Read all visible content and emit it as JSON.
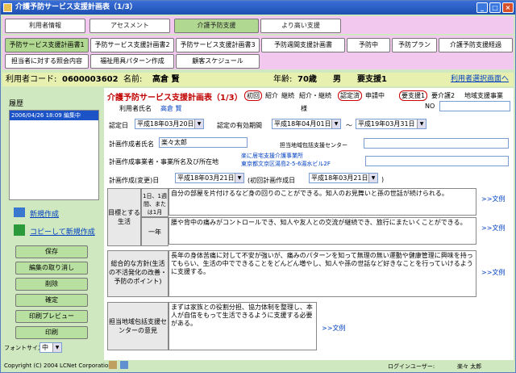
{
  "window": {
    "title": "介護予防サービス支援計画表（1/3）",
    "min": "_",
    "max": "□",
    "close": "×"
  },
  "tabs1": [
    "利用者情報",
    "アセスメント",
    "介護予防支援",
    "より高い支援"
  ],
  "tabs2": [
    "予防サービス支援計画書1",
    "予防サービス支援計画書2",
    "予防サービス支援計画書3",
    "予防週間支援計画書",
    "予防中",
    "予防プラン",
    "介護予防支援経過",
    "担当者に対する照会内容",
    "福祉用具パターン作成",
    "顧客スケジュール"
  ],
  "userbar": {
    "code_label": "利用者コード:",
    "code": "0600003602",
    "name_label": "名前:",
    "name": "高倉 賢",
    "age_label": "年齢:",
    "age": "70歳",
    "sex": "男",
    "care": "要支援1",
    "select_link": "利用者選択画面へ"
  },
  "sidebar": {
    "history_label": "履歴",
    "history_item": "2006/04/26 18:09 編集中",
    "new_link": "新規作成",
    "copy_link": "コピーして新規作成",
    "buttons": [
      "保存",
      "編集の取り消し",
      "削除",
      "確定",
      "印刷プレビュー",
      "印刷"
    ],
    "font_label": "フォントサイズ",
    "font_value": "中"
  },
  "form": {
    "title": "介護予防サービス支援計画表（1/3）",
    "badge1": "初回",
    "opt1": "紹介",
    "opt2": "継続",
    "opt3": "紹介・継続",
    "badge2": "認定済",
    "opt4": "申請中",
    "badge3": "要支援1",
    "opt5": "要介護2",
    "opt6": "地域支援事業",
    "no_label": "NO",
    "user_name_label": "利用者氏名",
    "user_name": "高倉 賢",
    "sama": "様",
    "cert_date_label": "認定日",
    "cert_date": "平成18年03月20日",
    "valid_label": "認定の有効期間",
    "valid_from": "平成18年04月01日",
    "tilde": "～",
    "valid_to": "平成19年03月31日",
    "creator_label": "計画作成者氏名",
    "creator": "楽々太郎",
    "center_label": "担当地域包括支援センター",
    "office_label": "計画作成事業者・事業所名及び所在地",
    "office_name": "楽に居宅支援介護事業所",
    "office_addr": "東京都文京区湯島2-5-6湯水ビル2F",
    "plan_date_label": "計画作成(変更)日",
    "plan_date": "平成18年03月21日",
    "first_label": "(初回計画作成日",
    "first_date": "平成18年03月21日",
    "close_paren": ")",
    "goal_label": "目標とする生活",
    "day_label": "1日、1週間、または1月",
    "year_label": "一年",
    "goal_day": "自分の部屋を片付けるなど身の回りのことができる。知人のお見舞いと孫の世話が続けられる。",
    "goal_year": "腰や背中の痛みがコントロールでき、知人や友人との交流が継続でき、旅行にまたいくことができる。",
    "policy_label": "総合的な方針(生活の不活発化の改善・予防のポイント)",
    "policy": "長年の身体苦痛に対して不安が強いが、痛みのパターンを知って無理の無い運動や健康管理に興味を持ってもらい、生活の中でできることをどんどん増やし、知人や孫の世話など好きなことを行っていけるように支援する。",
    "center_opinion_label": "担当地域包括支援センターの意見",
    "center_opinion": "まずは家族との役割分担、協力体制を整理し、本人が自信をもって生活できるように支援する必要がある。",
    "example_link": ">>文例"
  },
  "status": {
    "copyright": "Copyright (C) 2004 LCNet Corporation",
    "login_label": "ログインユーザー:",
    "login_user": "楽々 太郎"
  }
}
